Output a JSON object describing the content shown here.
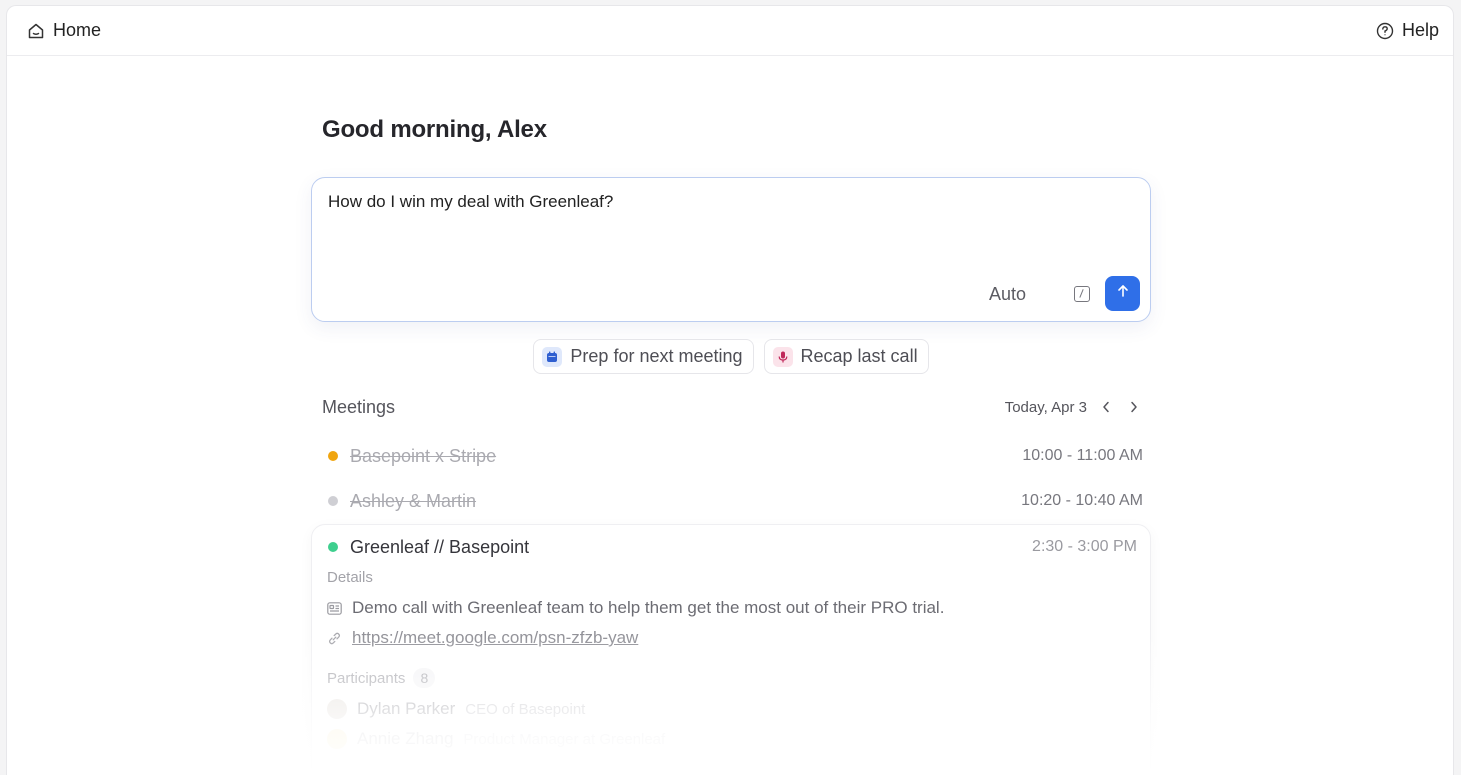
{
  "topbar": {
    "home_label": "Home",
    "help_label": "Help"
  },
  "greeting": "Good morning, Alex",
  "composer": {
    "value": "How do I win my deal with Greenleaf?",
    "mode_label": "Auto"
  },
  "suggestions": [
    {
      "label": "Prep for next meeting",
      "icon": "calendar-icon",
      "color": "#2f5fd0"
    },
    {
      "label": "Recap last call",
      "icon": "microphone-icon",
      "color": "#c0285a"
    }
  ],
  "meetings": {
    "title": "Meetings",
    "date_label": "Today, Apr 3",
    "items": [
      {
        "title": "Basepoint x Stripe",
        "time": "10:00 - 11:00 AM",
        "status_color": "#f0a50f",
        "done": true
      },
      {
        "title": "Ashley & Martin",
        "time": "10:20 - 10:40 AM",
        "status_color": "#cfcfd4",
        "done": true
      },
      {
        "title": "Greenleaf // Basepoint",
        "time": "2:30 - 3:00 PM",
        "status_color": "#3ecf8e",
        "done": false
      }
    ],
    "expanded": {
      "details_label": "Details",
      "description": "Demo call with Greenleaf team to help them get the most out of their PRO trial.",
      "link": "https://meet.google.com/psn-zfzb-yaw",
      "participants_label": "Participants",
      "participants_count": "8",
      "participants": [
        {
          "name": "Dylan Parker",
          "role": "CEO of Basepoint"
        },
        {
          "name": "Annie Zhang",
          "role": "Product Manager at Greenleaf"
        }
      ]
    }
  },
  "colors": {
    "accent": "#2f6fe8",
    "composer_border": "#bccdf0"
  }
}
